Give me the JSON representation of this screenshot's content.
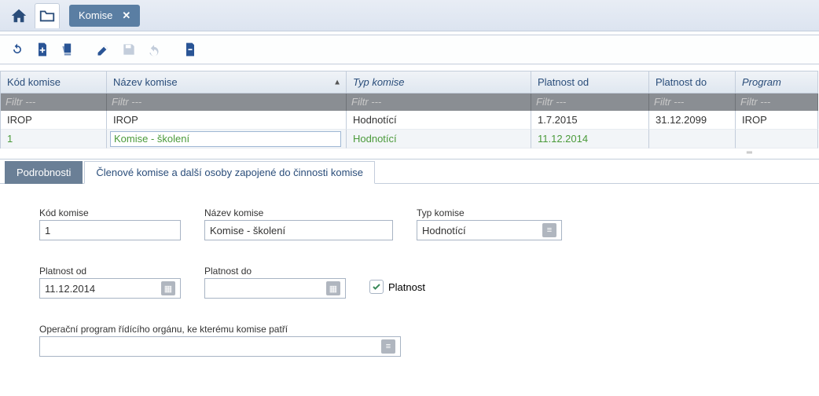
{
  "top": {
    "tab_label": "Komise",
    "tab_close": "✕"
  },
  "grid": {
    "headers": {
      "kod": "Kód komise",
      "nazev": "Název komise",
      "typ": "Typ komise",
      "od": "Platnost od",
      "do": "Platnost do",
      "program": "Program"
    },
    "filter_placeholder": "Filtr ---",
    "rows": [
      {
        "kod": "IROP",
        "nazev": "IROP",
        "typ": "Hodnotící",
        "od": "1.7.2015",
        "do": "31.12.2099",
        "program": "IROP"
      },
      {
        "kod": "1",
        "nazev": "Komise - školení",
        "typ": "Hodnotící",
        "od": "11.12.2014",
        "do": "",
        "program": ""
      }
    ]
  },
  "tabs": {
    "detail": "Podrobnosti",
    "members": "Členové komise a další osoby zapojené do činnosti komise"
  },
  "form": {
    "kod_label": "Kód komise",
    "kod_value": "1",
    "nazev_label": "Název komise",
    "nazev_value": "Komise - školení",
    "typ_label": "Typ komise",
    "typ_value": "Hodnotící",
    "od_label": "Platnost od",
    "od_value": "11.12.2014",
    "do_label": "Platnost do",
    "do_value": "",
    "platnost_check_label": "Platnost",
    "op_label": "Operační program řídícího orgánu, ke kterému komise patří",
    "op_value": ""
  }
}
